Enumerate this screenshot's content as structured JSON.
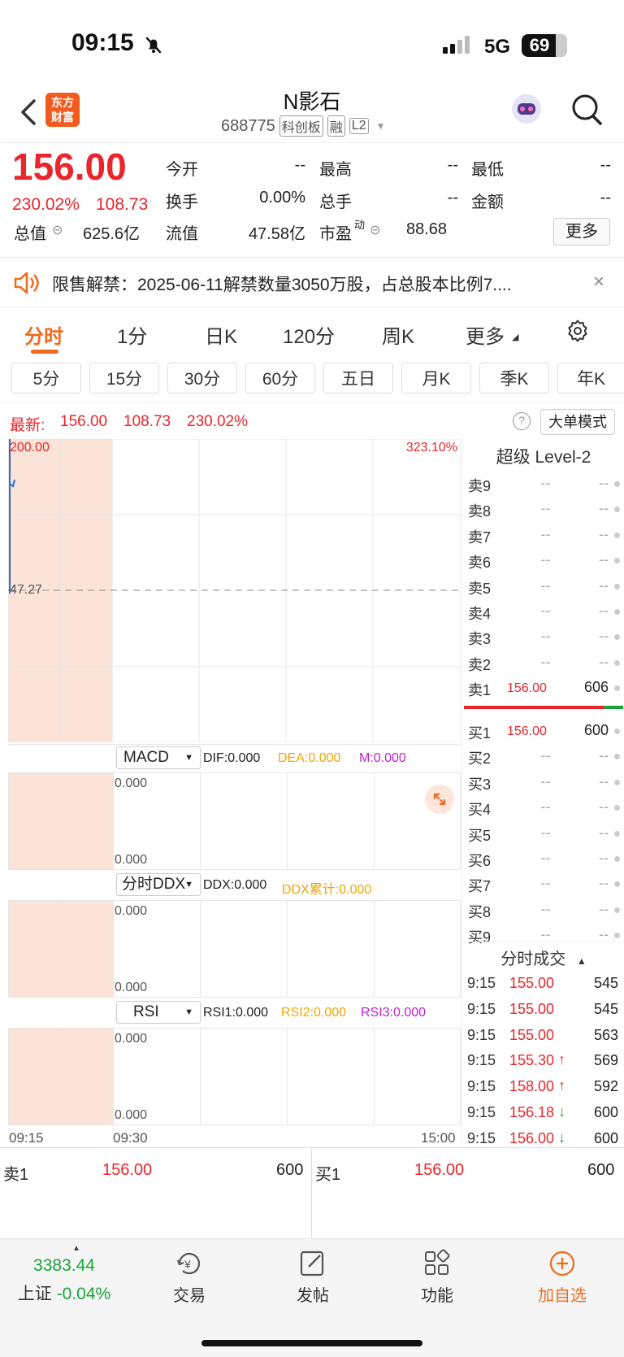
{
  "status": {
    "time": "09:15",
    "network": "5G",
    "battery": "69"
  },
  "header": {
    "logo_line1": "东方",
    "logo_line2": "财富",
    "title": "N影石",
    "code": "688775",
    "badges": [
      "科创板",
      "融",
      "L2"
    ]
  },
  "quote": {
    "price": "156.00",
    "change_pct": "230.02%",
    "change": "108.73",
    "today_open_label": "今开",
    "today_open": "--",
    "high_label": "最高",
    "high": "--",
    "low_label": "最低",
    "low": "--",
    "turnover_label": "换手",
    "turnover": "0.00%",
    "volume_label": "总手",
    "volume": "--",
    "amount_label": "金额",
    "amount": "--",
    "mcap_label": "总值",
    "mcap": "625.6亿",
    "float_label": "流值",
    "float": "47.58亿",
    "pe_label": "市盈",
    "pe_sup": "动",
    "pe": "88.68",
    "more": "更多"
  },
  "notice": {
    "text": "限售解禁：2025-06-11解禁数量3050万股，占总股本比例7...."
  },
  "tabs": [
    "分时",
    "1分",
    "日K",
    "120分",
    "周K",
    "更多"
  ],
  "subtabs": [
    "5分",
    "15分",
    "30分",
    "60分",
    "五日",
    "月K",
    "季K",
    "年K"
  ],
  "latest": {
    "label": "最新:",
    "price": "156.00",
    "change": "108.73",
    "pct": "230.02%",
    "mode": "大单模式"
  },
  "chart": {
    "price_top": "200.00",
    "pct_top": "323.10%",
    "ref": "47.27",
    "macd": {
      "name": "MACD",
      "dif": "DIF:0.000",
      "dea": "DEA:0.000",
      "m": "M:0.000",
      "top": "0.000",
      "bottom": "0.000"
    },
    "ddx": {
      "name": "分时DDX",
      "ddx": "DDX:0.000",
      "cum": "DDX累计:0.000",
      "top": "0.000",
      "bottom": "0.000"
    },
    "rsi": {
      "name": "RSI",
      "r1": "RSI1:0.000",
      "r2": "RSI2:0.000",
      "r3": "RSI3:0.000",
      "top": "0.000",
      "bottom": "0.000"
    },
    "time_start": "09:15",
    "time_mid": "09:30",
    "time_end": "15:00"
  },
  "orderbook": {
    "title": "超级 Level-2",
    "asks": [
      {
        "label": "卖9",
        "price": "--",
        "vol": "--"
      },
      {
        "label": "卖8",
        "price": "--",
        "vol": "--"
      },
      {
        "label": "卖7",
        "price": "--",
        "vol": "--"
      },
      {
        "label": "卖6",
        "price": "--",
        "vol": "--"
      },
      {
        "label": "卖5",
        "price": "--",
        "vol": "--"
      },
      {
        "label": "卖4",
        "price": "--",
        "vol": "--"
      },
      {
        "label": "卖3",
        "price": "--",
        "vol": "--"
      },
      {
        "label": "卖2",
        "price": "--",
        "vol": "--"
      },
      {
        "label": "卖1",
        "price": "156.00",
        "vol": "606"
      }
    ],
    "bids": [
      {
        "label": "买1",
        "price": "156.00",
        "vol": "600"
      },
      {
        "label": "买2",
        "price": "--",
        "vol": "--"
      },
      {
        "label": "买3",
        "price": "--",
        "vol": "--"
      },
      {
        "label": "买4",
        "price": "--",
        "vol": "--"
      },
      {
        "label": "买5",
        "price": "--",
        "vol": "--"
      },
      {
        "label": "买6",
        "price": "--",
        "vol": "--"
      },
      {
        "label": "买7",
        "price": "--",
        "vol": "--"
      },
      {
        "label": "买8",
        "price": "--",
        "vol": "--"
      },
      {
        "label": "买9",
        "price": "--",
        "vol": "--"
      }
    ]
  },
  "ticks": {
    "title": "分时成交",
    "rows": [
      {
        "time": "9:15",
        "price": "155.00",
        "arrow": "",
        "vol": "545"
      },
      {
        "time": "9:15",
        "price": "155.00",
        "arrow": "",
        "vol": "545"
      },
      {
        "time": "9:15",
        "price": "155.00",
        "arrow": "",
        "vol": "563"
      },
      {
        "time": "9:15",
        "price": "155.30",
        "arrow": "↑",
        "vol": "569"
      },
      {
        "time": "9:15",
        "price": "158.00",
        "arrow": "↑",
        "vol": "592"
      },
      {
        "time": "9:15",
        "price": "156.18",
        "arrow": "↓",
        "vol": "600"
      },
      {
        "time": "9:15",
        "price": "156.00",
        "arrow": "↓",
        "vol": "600"
      }
    ]
  },
  "bottom_quote": {
    "sell_label": "卖1",
    "sell_price": "156.00",
    "sell_vol": "600",
    "buy_label": "买1",
    "buy_price": "156.00",
    "buy_vol": "600"
  },
  "bottom_nav": {
    "index_value": "3383.44",
    "index_name": "上证",
    "index_pct": "-0.04%",
    "items": [
      "交易",
      "发帖",
      "功能",
      "加自选"
    ]
  },
  "colors": {
    "up": "#e8262c",
    "down": "#1aa33b",
    "accent": "#f06a1d",
    "chart_fill": "#fbe3d8"
  }
}
